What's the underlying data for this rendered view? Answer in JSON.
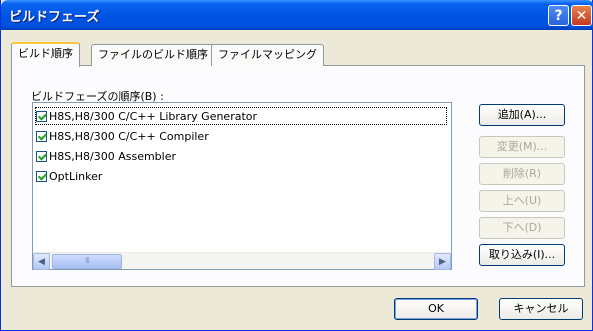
{
  "window": {
    "title": "ビルドフェーズ",
    "help_glyph": "?",
    "close_glyph": "✕"
  },
  "tabs": [
    {
      "label": "ビルド順序",
      "active": true
    },
    {
      "label": "ファイルのビルド順序",
      "active": false
    },
    {
      "label": "ファイルマッピング",
      "active": false
    }
  ],
  "list": {
    "label": "ビルドフェーズの順序(B) :",
    "items": [
      {
        "label": "H8S,H8/300 C/C++ Library Generator",
        "checked": true
      },
      {
        "label": "H8S,H8/300 C/C++ Compiler",
        "checked": true
      },
      {
        "label": "H8S,H8/300 Assembler",
        "checked": true
      },
      {
        "label": "OptLinker",
        "checked": true
      }
    ],
    "scroll_left": "◀",
    "scroll_right": "▶",
    "thumb_grip": "III"
  },
  "side_buttons": {
    "add": "追加(A)...",
    "modify": "変更(M)...",
    "delete": "削除(R)",
    "up": "上へ(U)",
    "down": "下へ(D)",
    "import": "取り込み(I)..."
  },
  "footer": {
    "ok": "OK",
    "cancel": "キャンセル"
  },
  "colors": {
    "title_bar": "#0055e5",
    "dialog_bg": "#ece9d8",
    "active_tab_accent": "#ffc83c",
    "check_mark": "#21a121"
  }
}
